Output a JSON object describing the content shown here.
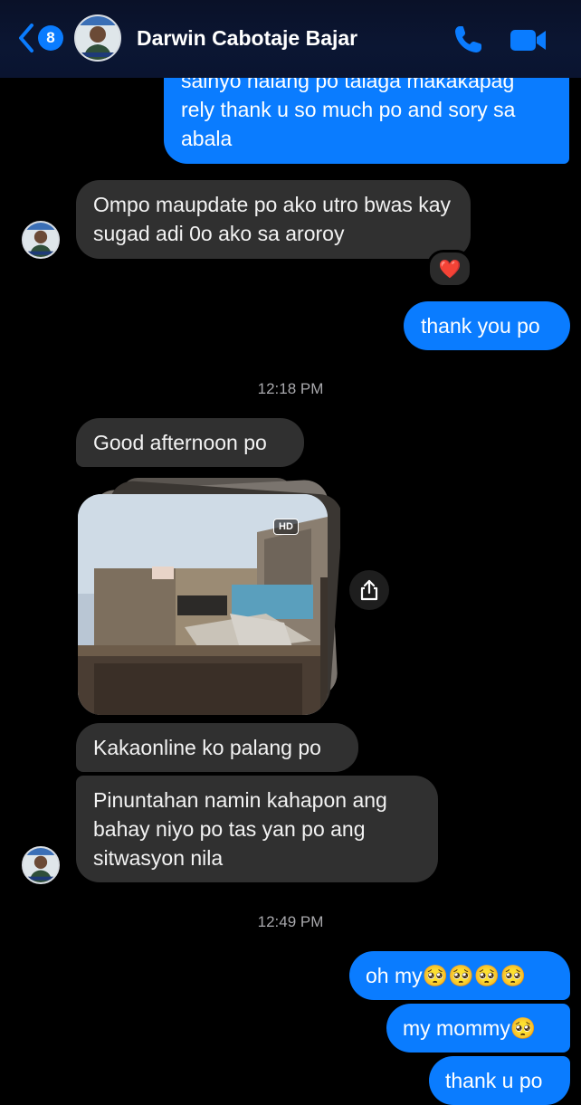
{
  "header": {
    "back_count": "8",
    "contact_name": "Darwin Cabotaje Bajar"
  },
  "messages": [
    {
      "text": "sainyo nalang po talaga makakapag rely thank u so much po and sory sa abala"
    },
    {
      "text": "Ompo maupdate po ako utro bwas kay sugad adi 0o ako sa aroroy",
      "reaction": "❤️"
    },
    {
      "text": "thank you po"
    },
    {
      "text": "Good afternoon po"
    },
    {
      "text": "Kakaonline ko palang po"
    },
    {
      "text": "Pinuntahan namin kahapon ang bahay niyo po tas yan po ang sitwasyon nila"
    },
    {
      "text": "oh my🥺🥺🥺🥺"
    },
    {
      "text": "my mommy🥺"
    },
    {
      "text": "thank u po"
    }
  ],
  "timestamps": [
    "12:18 PM",
    "12:49 PM"
  ],
  "photo": {
    "hd_label": "HD"
  },
  "colors": {
    "outgoing": "#0a7cff",
    "incoming": "#303030",
    "background": "#000000"
  }
}
